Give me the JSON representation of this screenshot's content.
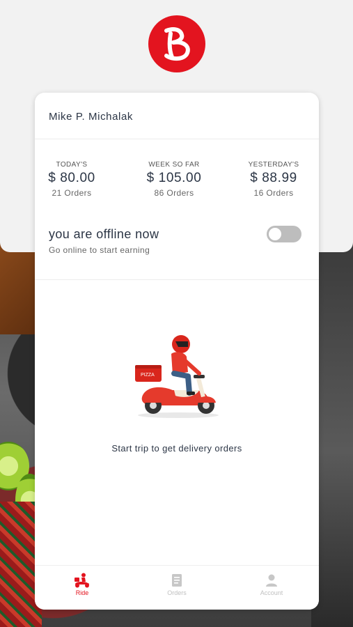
{
  "user": {
    "name": "Mike P. Michalak"
  },
  "stats": [
    {
      "label": "TODAY'S",
      "amount": "$ 80.00",
      "orders": "21 Orders"
    },
    {
      "label": "WEEK SO FAR",
      "amount": "$ 105.00",
      "orders": "86 Orders"
    },
    {
      "label": "YESTERDAY'S",
      "amount": "$ 88.99",
      "orders": "16 Orders"
    }
  ],
  "status": {
    "title": "you are offline now",
    "subtitle": "Go online to start earning",
    "online": false
  },
  "empty_state": {
    "message": "Start trip to get delivery orders",
    "illustration_icon": "scooter-delivery-illustration",
    "box_text": "PIZZA"
  },
  "nav": [
    {
      "label": "Ride",
      "icon": "scooter-icon",
      "active": true
    },
    {
      "label": "Orders",
      "icon": "document-icon",
      "active": false
    },
    {
      "label": "Account",
      "icon": "person-icon",
      "active": false
    }
  ],
  "colors": {
    "brand": "#e3141f",
    "text": "#2b3545",
    "toggle_off": "#bdbdbd"
  }
}
